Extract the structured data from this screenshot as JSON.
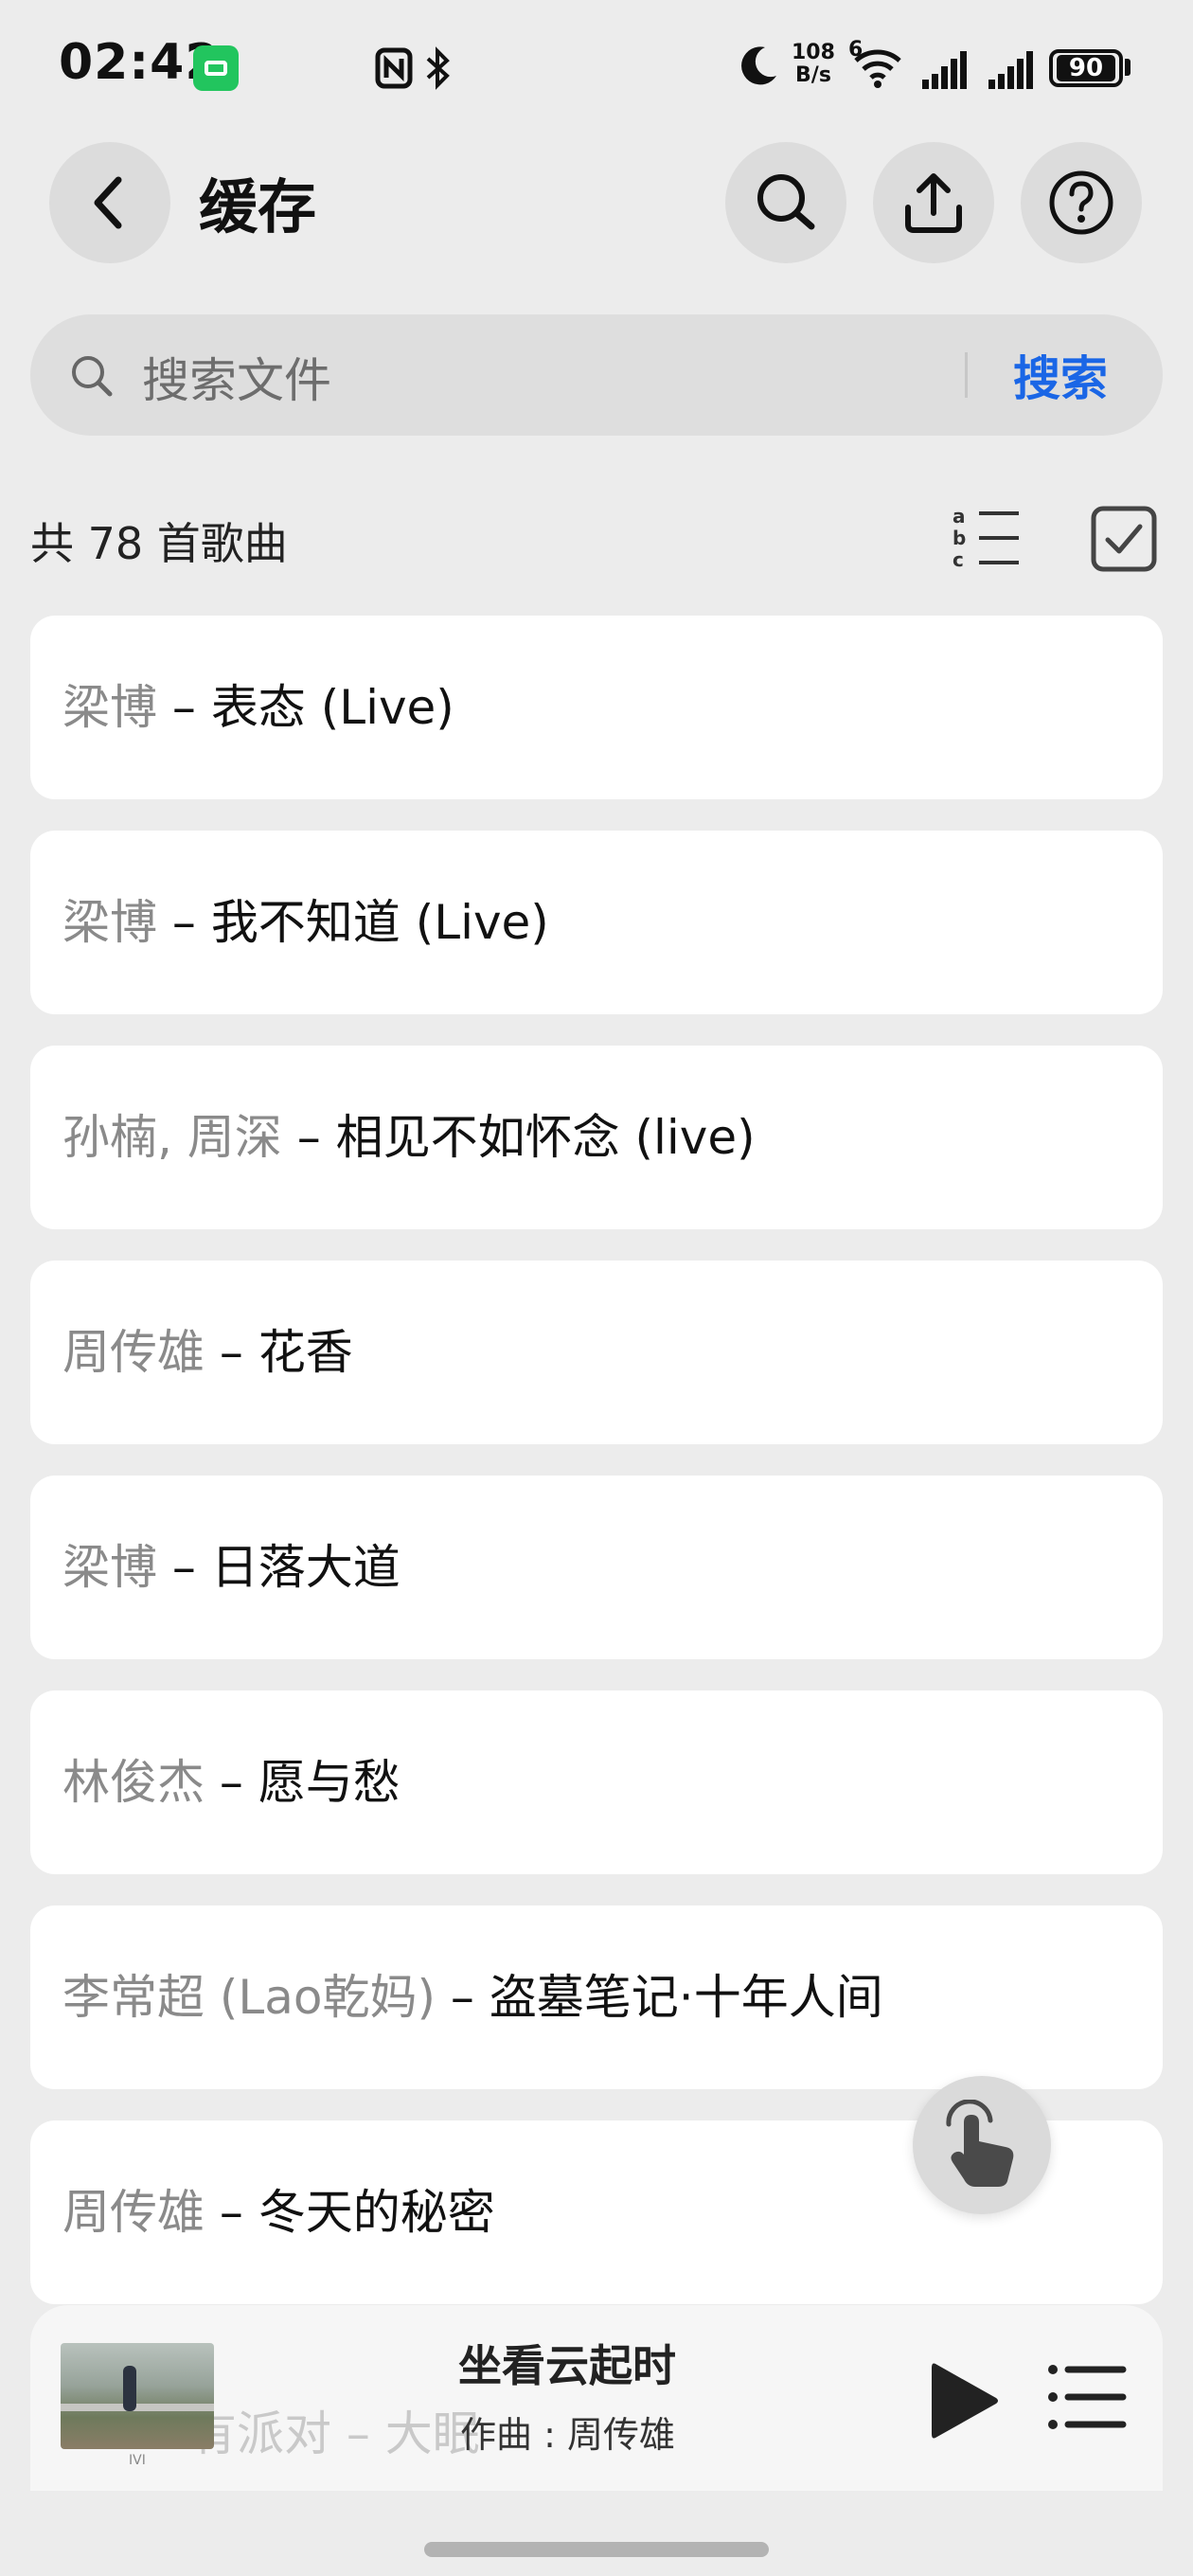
{
  "status_bar": {
    "time": "02:42",
    "app_icon": "wechat-icon",
    "left_icons": [
      "nfc-icon",
      "bluetooth-icon"
    ],
    "net_speed_value": "108",
    "net_speed_unit": "B/s",
    "right_icons": [
      "moon-icon",
      "wifi-icon",
      "signal-icon",
      "signal-icon"
    ],
    "wifi_label": "6",
    "battery": "90"
  },
  "header": {
    "title": "缓存",
    "icons": [
      "back-icon",
      "search-icon",
      "upload-icon",
      "help-icon"
    ]
  },
  "search": {
    "placeholder": "搜索文件",
    "button": "搜索"
  },
  "list_header": {
    "count_text": "共 78 首歌曲",
    "icons": [
      "sort-alpha-icon",
      "select-checkbox-icon"
    ]
  },
  "songs": [
    {
      "artist": "梁博",
      "title": "表态 (Live)"
    },
    {
      "artist": "梁博",
      "title": "我不知道 (Live)"
    },
    {
      "artist": "孙楠, 周深",
      "title": "相见不如怀念 (live)"
    },
    {
      "artist": "周传雄",
      "title": "花香"
    },
    {
      "artist": "梁博",
      "title": "日落大道"
    },
    {
      "artist": "林俊杰",
      "title": "愿与愁"
    },
    {
      "artist": "李常超 (Lao乾妈)",
      "title": "盗墓笔记·十年人间"
    },
    {
      "artist": "周传雄",
      "title": "冬天的秘密"
    }
  ],
  "partial_row_text": "有派对 – 大眠",
  "player": {
    "title": "坐看云起时",
    "subtitle": "作曲 : 周传雄",
    "cover_badge": "IVI",
    "icons": [
      "play-icon",
      "playlist-icon"
    ]
  },
  "floating": {
    "icon": "hand-touch-icon"
  },
  "colors": {
    "accent": "#1a66e6",
    "background": "#ececec",
    "card": "#ffffff"
  }
}
